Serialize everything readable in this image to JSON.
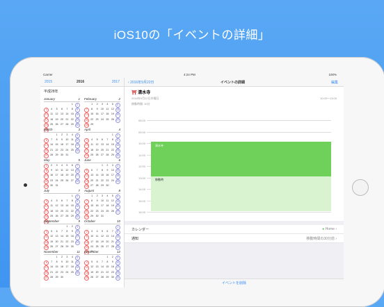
{
  "headline": "iOS10の「イベントの詳細」",
  "status": {
    "carrier": "Carrier",
    "time": "4:24 PM",
    "battery": "100%"
  },
  "calendar": {
    "prev_year": "2015",
    "year": "2016",
    "next_year": "2017",
    "era": "平成28年",
    "months": [
      {
        "name": "January",
        "num": "1",
        "start": 5,
        "days": 31
      },
      {
        "name": "February",
        "num": "2",
        "start": 1,
        "days": 29
      },
      {
        "name": "March",
        "num": "3",
        "start": 2,
        "days": 31
      },
      {
        "name": "April",
        "num": "4",
        "start": 5,
        "days": 30
      },
      {
        "name": "May",
        "num": "5",
        "start": 0,
        "days": 31
      },
      {
        "name": "June",
        "num": "6",
        "start": 3,
        "days": 30
      },
      {
        "name": "July",
        "num": "7",
        "start": 5,
        "days": 31
      },
      {
        "name": "August",
        "num": "8",
        "start": 1,
        "days": 31
      },
      {
        "name": "September",
        "num": "9",
        "start": 4,
        "days": 30
      },
      {
        "name": "October",
        "num": "10",
        "start": 6,
        "days": 31
      },
      {
        "name": "November",
        "num": "11",
        "start": 2,
        "days": 30
      },
      {
        "name": "December",
        "num": "12",
        "start": 4,
        "days": 31
      }
    ]
  },
  "detail": {
    "back": "2016年9月22日",
    "nav_title": "イベントの詳細",
    "edit": "編集",
    "event_title": "清水寺",
    "date": "2016年9月22日木曜日",
    "time_range": "10:00～13:00",
    "travel": "移動時間: 30分",
    "hours": [
      "08:00",
      "09:00",
      "10:00",
      "11:00",
      "12:00",
      "13:00",
      "14:00",
      "15:00",
      "16:00"
    ],
    "event_label": "清水寺",
    "travel_label": "移動時",
    "calendar_label": "カレンダー",
    "calendar_value": "Home",
    "alert_label": "通知",
    "alert_value": "移動時間の30分前",
    "delete": "イベントを削除"
  }
}
